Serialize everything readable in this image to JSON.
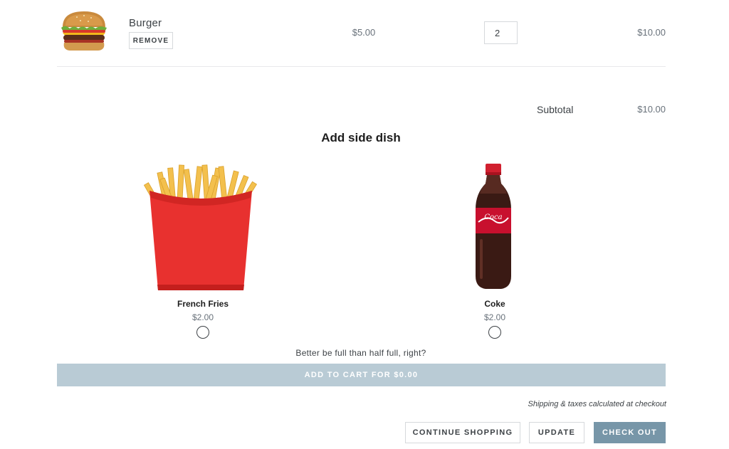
{
  "cart": {
    "item": {
      "name": "Burger",
      "remove_label": "REMOVE",
      "unit_price": "$5.00",
      "quantity": "2",
      "line_total": "$10.00"
    },
    "subtotal_label": "Subtotal",
    "subtotal_value": "$10.00"
  },
  "side_dish": {
    "title": "Add side dish",
    "options": [
      {
        "name": "French Fries",
        "price": "$2.00"
      },
      {
        "name": "Coke",
        "price": "$2.00"
      }
    ],
    "tagline": "Better be full than half full, right?",
    "add_button": "ADD TO CART FOR $0.00"
  },
  "footer": {
    "shipping_note": "Shipping & taxes calculated at checkout",
    "continue_label": "CONTINUE SHOPPING",
    "update_label": "UPDATE",
    "checkout_label": "CHECK OUT"
  },
  "colors": {
    "add_button_bg": "#b9cbd5",
    "checkout_bg": "#7796a8",
    "fries_box": "#e8312f",
    "coke_label": "#c8102e"
  }
}
